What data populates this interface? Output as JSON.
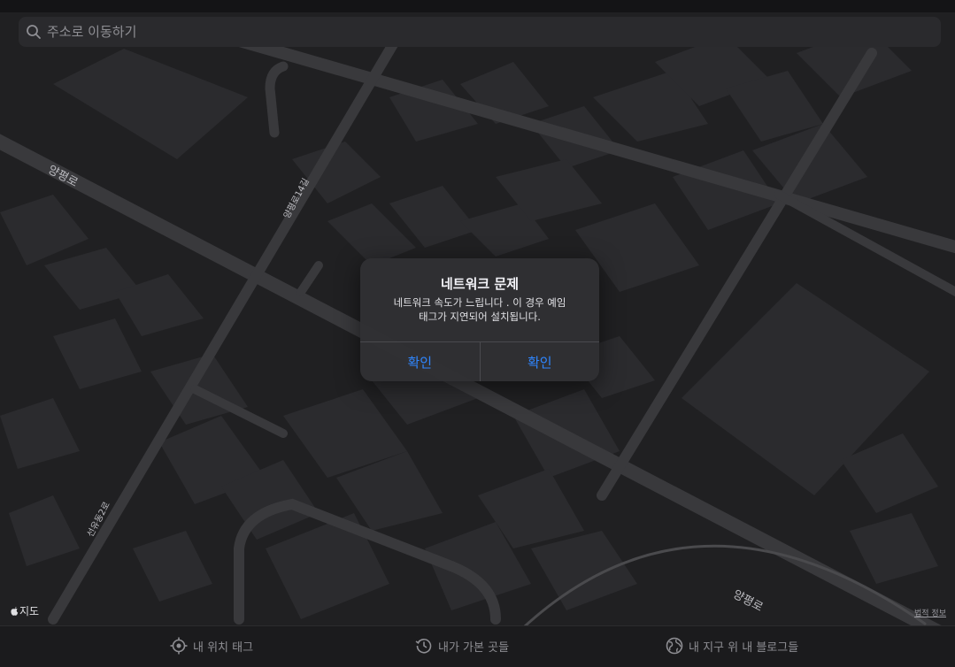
{
  "search": {
    "placeholder": "주소로 이동하기"
  },
  "map": {
    "street_labels": [
      "양평로",
      "양평로14길",
      "선유동2로",
      "양평로"
    ],
    "attribution": "지도",
    "legal_link": "법적 정보"
  },
  "alert": {
    "title": "네트워크 문제",
    "message_line1": "네트워크 속도가 느립니다 . 이 경우 예임",
    "message_line2": "태그가 지연되어 설치됩니다.",
    "button_left": "확인",
    "button_right": "확인"
  },
  "tabbar": {
    "items": [
      {
        "label": "내 위치 태그",
        "icon": "location-target-icon"
      },
      {
        "label": "내가 가본 곳들",
        "icon": "history-clock-icon"
      },
      {
        "label": "내 지구 위 내 블로그들",
        "icon": "globe-icon"
      }
    ]
  },
  "colors": {
    "background": "#202022",
    "road": "#3a3a3d",
    "building": "#2c2c2f",
    "accent_blue": "#2f86ff"
  }
}
